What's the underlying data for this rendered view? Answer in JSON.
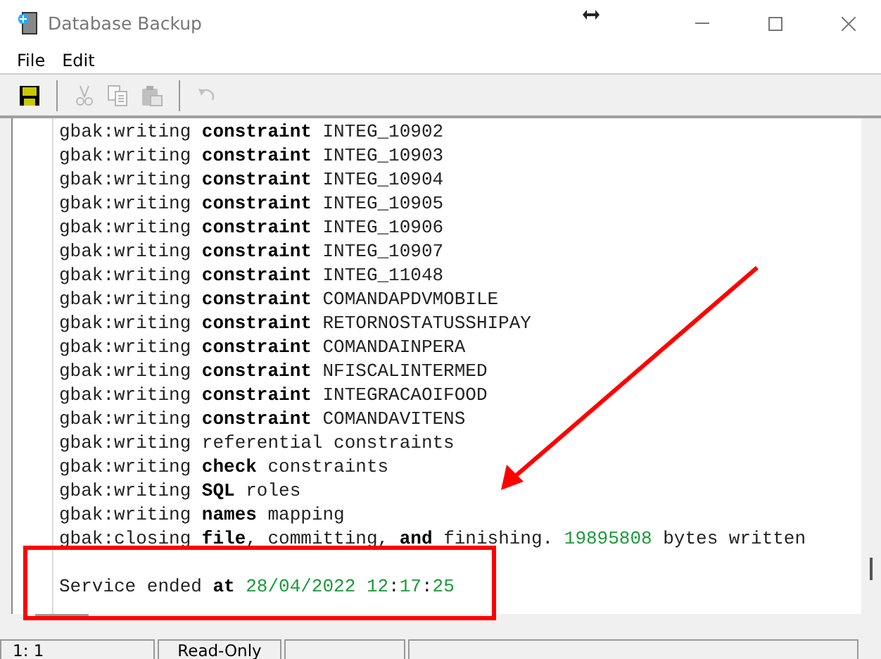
{
  "window": {
    "title": "Database Backup"
  },
  "menu": [
    "File",
    "Edit"
  ],
  "toolbar": [
    {
      "kind": "save",
      "disabled": false
    },
    {
      "kind": "separator"
    },
    {
      "kind": "cut",
      "disabled": true
    },
    {
      "kind": "copy",
      "disabled": true
    },
    {
      "kind": "paste",
      "disabled": true
    },
    {
      "kind": "separator"
    },
    {
      "kind": "undo",
      "disabled": true
    }
  ],
  "log": [
    [
      {
        "kind": "plain",
        "text": "gbak:writing "
      },
      {
        "kind": "keyword",
        "text": "constraint"
      },
      {
        "kind": "plain",
        "text": " INTEG_10902"
      }
    ],
    [
      {
        "kind": "plain",
        "text": "gbak:writing "
      },
      {
        "kind": "keyword",
        "text": "constraint"
      },
      {
        "kind": "plain",
        "text": " INTEG_10903"
      }
    ],
    [
      {
        "kind": "plain",
        "text": "gbak:writing "
      },
      {
        "kind": "keyword",
        "text": "constraint"
      },
      {
        "kind": "plain",
        "text": " INTEG_10904"
      }
    ],
    [
      {
        "kind": "plain",
        "text": "gbak:writing "
      },
      {
        "kind": "keyword",
        "text": "constraint"
      },
      {
        "kind": "plain",
        "text": " INTEG_10905"
      }
    ],
    [
      {
        "kind": "plain",
        "text": "gbak:writing "
      },
      {
        "kind": "keyword",
        "text": "constraint"
      },
      {
        "kind": "plain",
        "text": " INTEG_10906"
      }
    ],
    [
      {
        "kind": "plain",
        "text": "gbak:writing "
      },
      {
        "kind": "keyword",
        "text": "constraint"
      },
      {
        "kind": "plain",
        "text": " INTEG_10907"
      }
    ],
    [
      {
        "kind": "plain",
        "text": "gbak:writing "
      },
      {
        "kind": "keyword",
        "text": "constraint"
      },
      {
        "kind": "plain",
        "text": " INTEG_11048"
      }
    ],
    [
      {
        "kind": "plain",
        "text": "gbak:writing "
      },
      {
        "kind": "keyword",
        "text": "constraint"
      },
      {
        "kind": "plain",
        "text": " COMANDAPDVMOBILE"
      }
    ],
    [
      {
        "kind": "plain",
        "text": "gbak:writing "
      },
      {
        "kind": "keyword",
        "text": "constraint"
      },
      {
        "kind": "plain",
        "text": " RETORNOSTATUSSHIPAY"
      }
    ],
    [
      {
        "kind": "plain",
        "text": "gbak:writing "
      },
      {
        "kind": "keyword",
        "text": "constraint"
      },
      {
        "kind": "plain",
        "text": " COMANDAINPERA"
      }
    ],
    [
      {
        "kind": "plain",
        "text": "gbak:writing "
      },
      {
        "kind": "keyword",
        "text": "constraint"
      },
      {
        "kind": "plain",
        "text": " NFISCALINTERMED"
      }
    ],
    [
      {
        "kind": "plain",
        "text": "gbak:writing "
      },
      {
        "kind": "keyword",
        "text": "constraint"
      },
      {
        "kind": "plain",
        "text": " INTEGRACAOIFOOD"
      }
    ],
    [
      {
        "kind": "plain",
        "text": "gbak:writing "
      },
      {
        "kind": "keyword",
        "text": "constraint"
      },
      {
        "kind": "plain",
        "text": " COMANDAVITENS"
      }
    ],
    [
      {
        "kind": "plain",
        "text": "gbak:writing referential constraints"
      }
    ],
    [
      {
        "kind": "plain",
        "text": "gbak:writing "
      },
      {
        "kind": "keyword",
        "text": "check"
      },
      {
        "kind": "plain",
        "text": " constraints"
      }
    ],
    [
      {
        "kind": "plain",
        "text": "gbak:writing "
      },
      {
        "kind": "keyword",
        "text": "SQL"
      },
      {
        "kind": "plain",
        "text": " roles"
      }
    ],
    [
      {
        "kind": "plain",
        "text": "gbak:writing "
      },
      {
        "kind": "keyword",
        "text": "names"
      },
      {
        "kind": "plain",
        "text": " mapping"
      }
    ],
    [
      {
        "kind": "plain",
        "text": "gbak:closing "
      },
      {
        "kind": "keyword",
        "text": "file"
      },
      {
        "kind": "plain",
        "text": ", committing, "
      },
      {
        "kind": "keyword",
        "text": "and"
      },
      {
        "kind": "plain",
        "text": " finishing. "
      },
      {
        "kind": "number",
        "text": "19895808"
      },
      {
        "kind": "plain",
        "text": " bytes written"
      }
    ],
    [
      {
        "kind": "plain",
        "text": "Service ended "
      },
      {
        "kind": "keyword",
        "text": "at"
      },
      {
        "kind": "number",
        "text": " 28/04/2022 12"
      },
      {
        "kind": "plain",
        "text": ":"
      },
      {
        "kind": "number",
        "text": "17"
      },
      {
        "kind": "plain",
        "text": ":"
      },
      {
        "kind": "number",
        "text": "25"
      }
    ]
  ],
  "status_bar": [
    "1: 1",
    "Read-Only"
  ]
}
